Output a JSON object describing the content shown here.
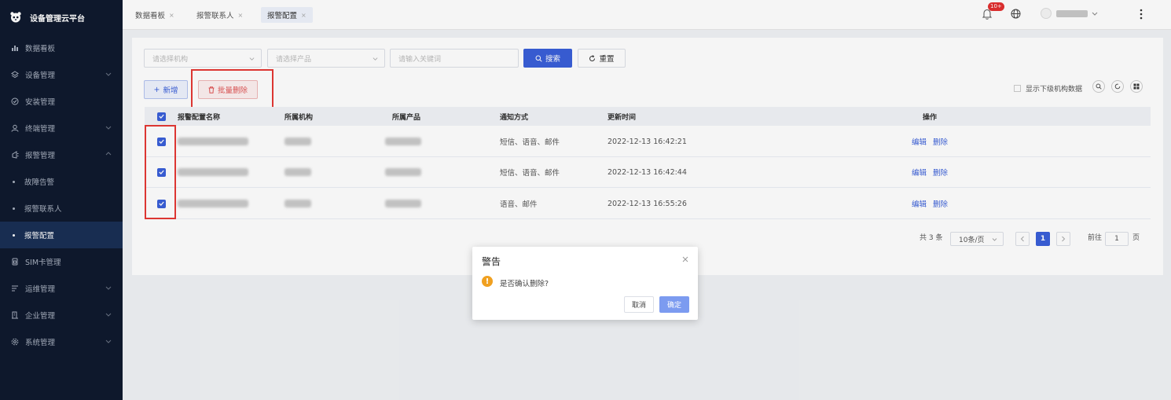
{
  "app": {
    "title": "设备管理云平台"
  },
  "sidebar": {
    "items": [
      {
        "label": "数据看板",
        "icon": "bar-chart-icon",
        "chevron": false
      },
      {
        "label": "设备管理",
        "icon": "device-icon",
        "chevron": true
      },
      {
        "label": "安装管理",
        "icon": "install-icon",
        "chevron": false
      },
      {
        "label": "终端管理",
        "icon": "user-icon",
        "chevron": true
      },
      {
        "label": "报警管理",
        "icon": "alarm-icon",
        "chevron": true
      },
      {
        "label": "故障告警",
        "icon": "",
        "sub": true
      },
      {
        "label": "报警联系人",
        "icon": "",
        "sub": true
      },
      {
        "label": "报警配置",
        "icon": "",
        "sub": true,
        "active": true
      },
      {
        "label": "SIM卡管理",
        "icon": "sim-card-icon",
        "chevron": false
      },
      {
        "label": "运维管理",
        "icon": "ops-icon",
        "chevron": true
      },
      {
        "label": "企业管理",
        "icon": "enterprise-icon",
        "chevron": true
      },
      {
        "label": "系统管理",
        "icon": "settings-icon",
        "chevron": true
      }
    ]
  },
  "tabs": [
    {
      "label": "数据看板"
    },
    {
      "label": "报警联系人"
    },
    {
      "label": "报警配置",
      "active": true
    }
  ],
  "header": {
    "badge": "10+"
  },
  "filters": {
    "org_placeholder": "请选择机构",
    "product_placeholder": "请选择产品",
    "keyword_placeholder": "请输入关键词",
    "search_label": "搜索",
    "reset_label": "重置"
  },
  "toolbar": {
    "add_label": "新增",
    "batch_delete_label": "批量删除",
    "show_sub_label": "显示下级机构数据"
  },
  "table": {
    "headers": [
      "报警配置名称",
      "所属机构",
      "所属产品",
      "通知方式",
      "更新时间",
      "操作"
    ],
    "rows": [
      {
        "notify": "短信、语音、邮件",
        "updated": "2022-12-13 16:42:21",
        "edit": "编辑",
        "delete": "删除"
      },
      {
        "notify": "短信、语音、邮件",
        "updated": "2022-12-13 16:42:44",
        "edit": "编辑",
        "delete": "删除"
      },
      {
        "notify": "语音、邮件",
        "updated": "2022-12-13 16:55:26",
        "edit": "编辑",
        "delete": "删除"
      }
    ]
  },
  "pagination": {
    "total": "共 3 条",
    "page_size": "10条/页",
    "current": "1",
    "goto_prefix": "前往",
    "goto_value": "1",
    "goto_suffix": "页"
  },
  "dialog": {
    "title": "警告",
    "message": "是否确认删除?",
    "cancel_label": "取消",
    "confirm_label": "确定"
  },
  "colors": {
    "primary": "#3a5fd9",
    "sidebar_bg": "#0f1a2e",
    "danger": "#e05555",
    "warning": "#f0a020",
    "highlight": "#e53935"
  }
}
